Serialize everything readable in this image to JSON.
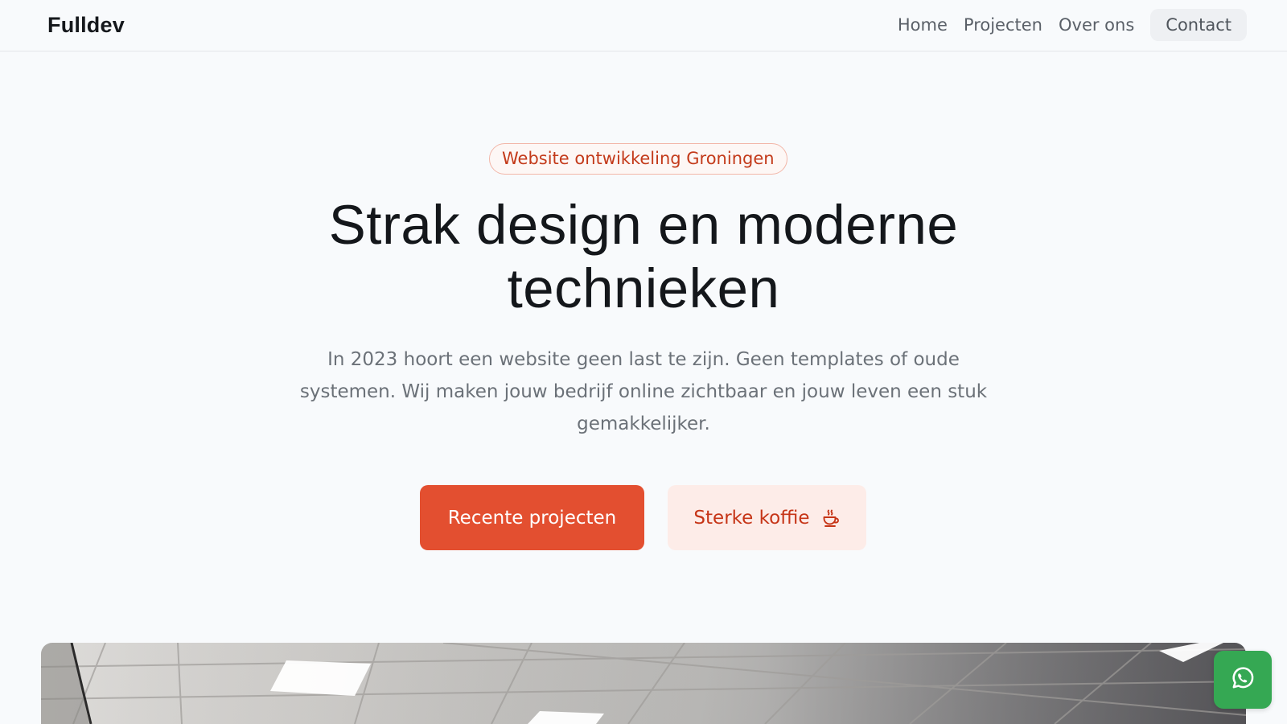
{
  "header": {
    "logo": "Fulldev",
    "nav": {
      "home": "Home",
      "projects": "Projecten",
      "about": "Over ons",
      "contact": "Contact"
    }
  },
  "hero": {
    "badge": "Website ontwikkeling Groningen",
    "title": "Strak design en moderne technieken",
    "text": "In 2023 hoort een website geen last te zijn. Geen templates of oude systemen. Wij maken jouw bedrijf online zichtbaar en jouw leven een stuk gemakkelijker.",
    "primary_button": "Recente projecten",
    "secondary_button": "Sterke koffie",
    "secondary_button_icon": "coffee-cup-icon"
  },
  "floating": {
    "whatsapp_icon": "whatsapp-icon"
  },
  "colors": {
    "accent": "#e34f30",
    "accent_light": "#fdece8",
    "badge_text": "#c33a1a",
    "whatsapp": "#35a853"
  }
}
